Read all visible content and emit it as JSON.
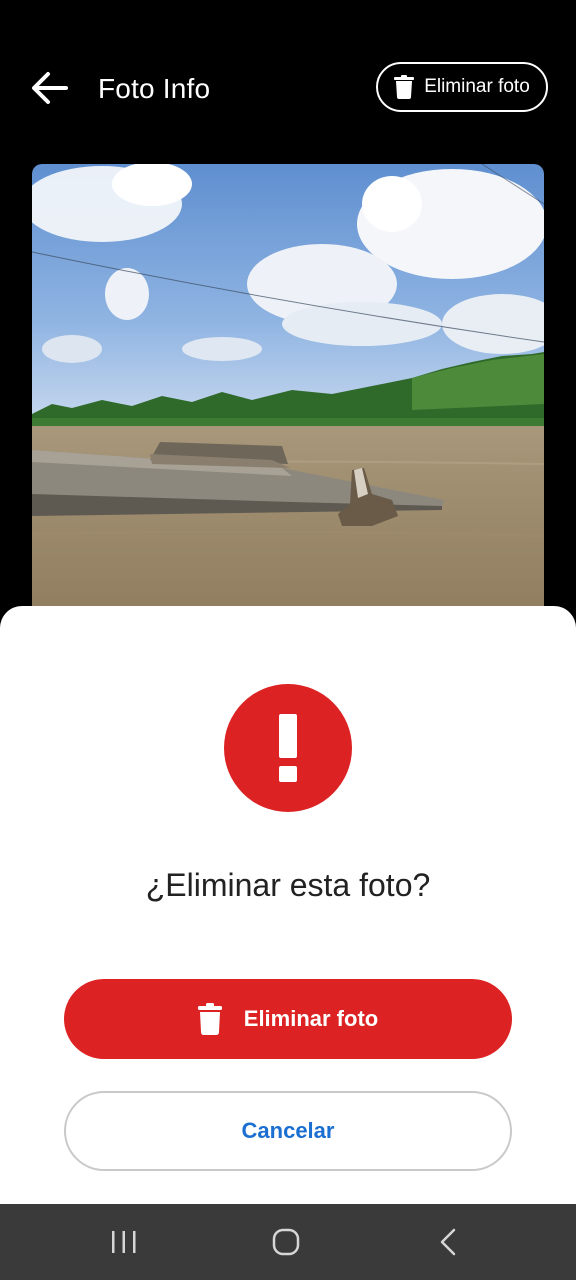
{
  "header": {
    "title": "Foto Info",
    "delete_label": "Eliminar foto",
    "back_icon": "arrow-left-icon",
    "delete_icon": "trash-icon"
  },
  "dialog": {
    "question": "¿Eliminar esta foto?",
    "alert_icon": "exclamation-icon",
    "alert_color": "#dc2222",
    "confirm_label": "Eliminar foto",
    "confirm_icon": "trash-icon",
    "cancel_label": "Cancelar",
    "cancel_color": "#1a6fd1"
  },
  "navbar": {
    "items": [
      "recent-apps-icon",
      "home-icon",
      "back-icon"
    ]
  }
}
